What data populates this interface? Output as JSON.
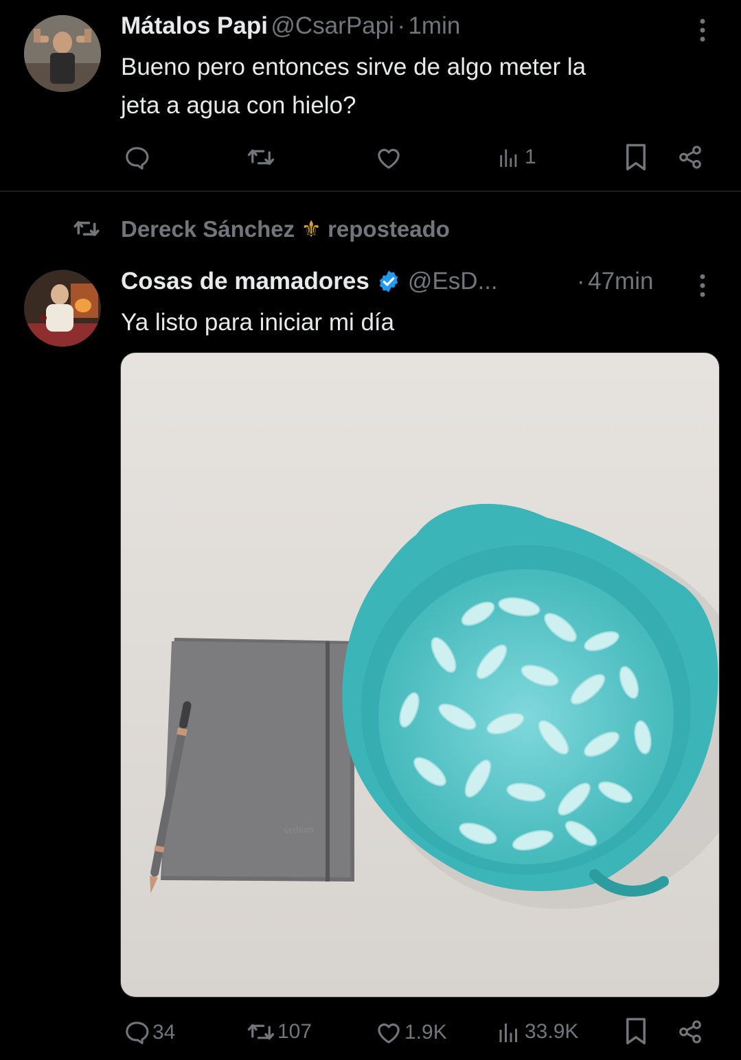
{
  "tweet1": {
    "name": "Mátalos Papi",
    "handle": "@CsarPapi",
    "sep": "·",
    "time": "1min",
    "text_line1": "Bueno pero entonces sirve de algo meter la",
    "text_line2": "jeta a agua con hielo?",
    "actions": {
      "views": "1"
    }
  },
  "repost": {
    "user": "Dereck Sánchez",
    "emoji": "⚜",
    "label": "reposteado"
  },
  "tweet2": {
    "name": "Cosas de mamadores",
    "handle": "@EsD...",
    "sep": "·",
    "time": "47min",
    "text": "Ya listo para iniciar mi día",
    "actions": {
      "replies": "34",
      "reposts": "107",
      "likes": "1.9K",
      "views": "33.9K"
    }
  },
  "colors": {
    "background": "#000000",
    "text": "#e7e9ea",
    "muted": "#71767b",
    "verified": "#1d9bf0",
    "divider": "#2f3336"
  }
}
